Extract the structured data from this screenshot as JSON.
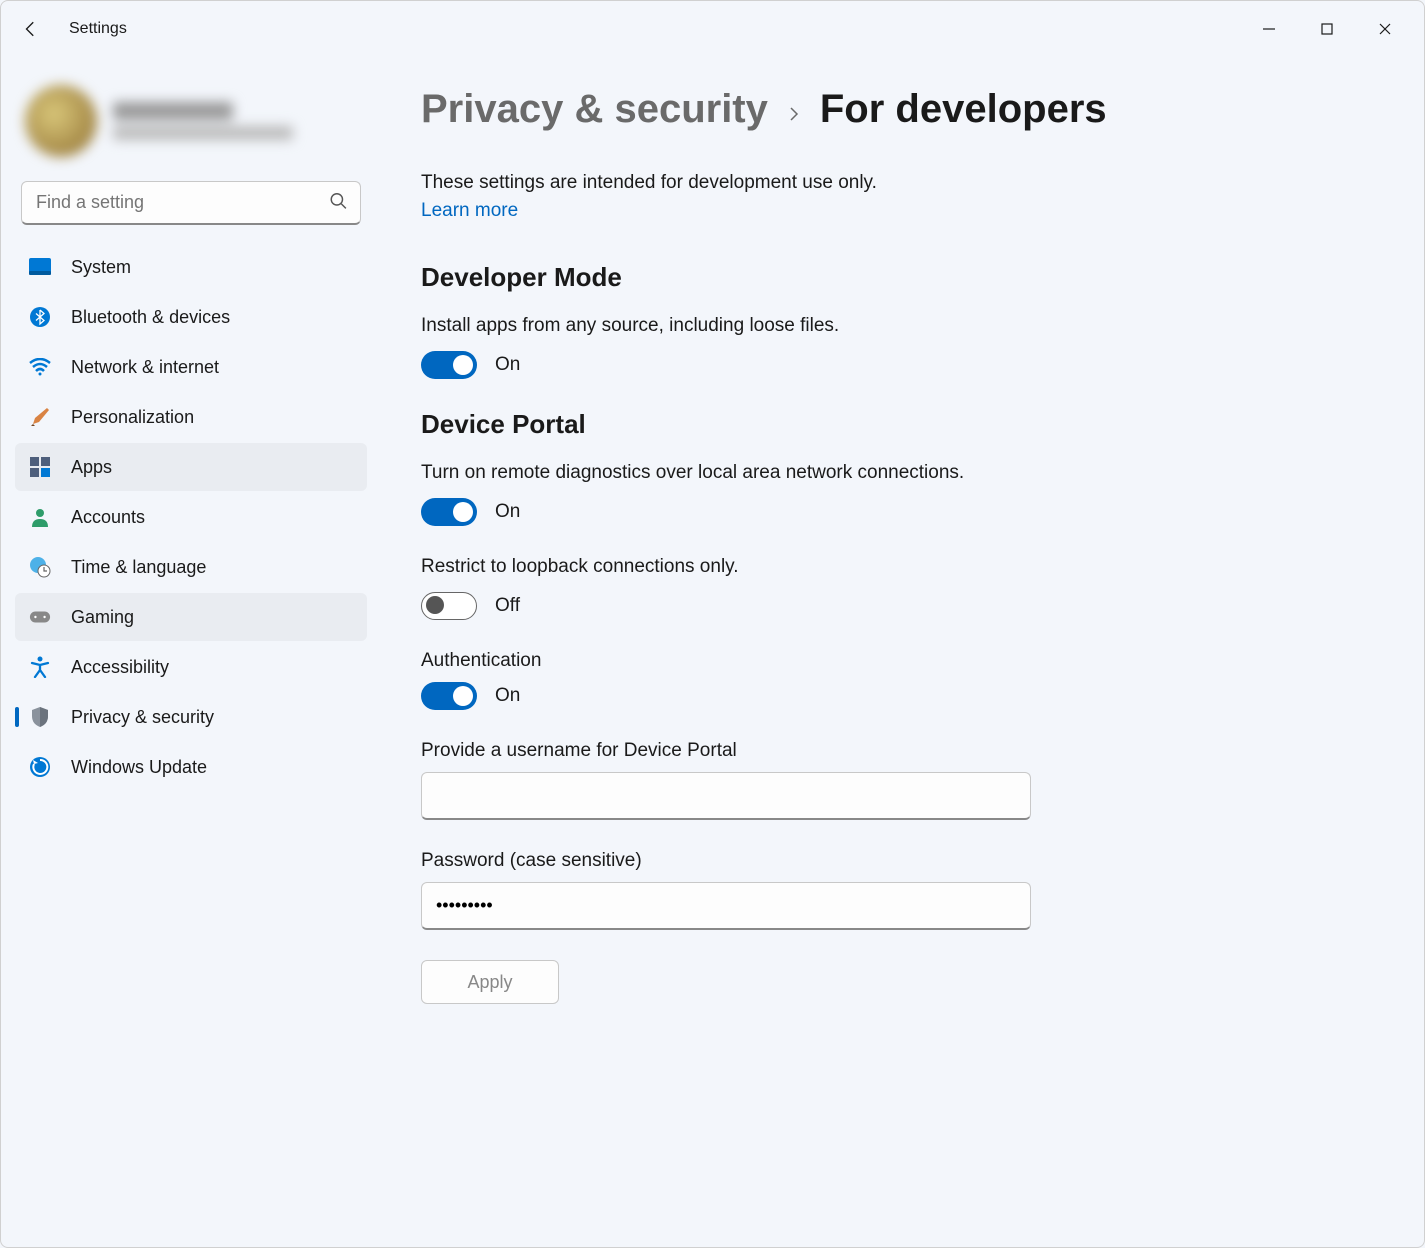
{
  "window": {
    "title": "Settings"
  },
  "search": {
    "placeholder": "Find a setting"
  },
  "sidebar": {
    "items": [
      {
        "label": "System"
      },
      {
        "label": "Bluetooth & devices"
      },
      {
        "label": "Network & internet"
      },
      {
        "label": "Personalization"
      },
      {
        "label": "Apps"
      },
      {
        "label": "Accounts"
      },
      {
        "label": "Time & language"
      },
      {
        "label": "Gaming"
      },
      {
        "label": "Accessibility"
      },
      {
        "label": "Privacy & security"
      },
      {
        "label": "Windows Update"
      }
    ]
  },
  "breadcrumb": {
    "parent": "Privacy & security",
    "current": "For developers"
  },
  "intro": "These settings are intended for development use only.",
  "learn_more": "Learn more",
  "dev_mode": {
    "heading": "Developer Mode",
    "desc": "Install apps from any source, including loose files.",
    "toggle_state": "On"
  },
  "device_portal": {
    "heading": "Device Portal",
    "desc1": "Turn on remote diagnostics over local area network connections.",
    "toggle1_state": "On",
    "desc2": "Restrict to loopback connections only.",
    "toggle2_state": "Off",
    "auth_label": "Authentication",
    "toggle3_state": "On",
    "username_label": "Provide a username for Device Portal",
    "username_value": "",
    "password_label": "Password (case sensitive)",
    "password_value": "•••••••••",
    "apply_label": "Apply"
  }
}
